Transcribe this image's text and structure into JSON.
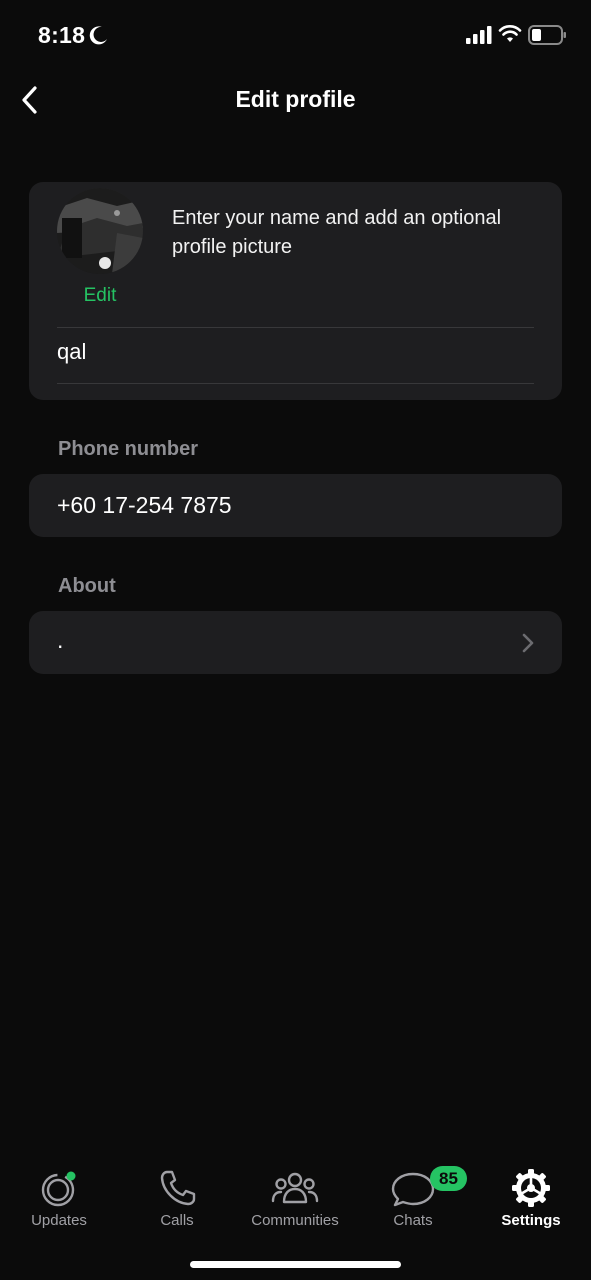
{
  "status_bar": {
    "time": "8:18"
  },
  "header": {
    "title": "Edit profile",
    "back_icon": "chevron-left-icon"
  },
  "profile": {
    "edit_label": "Edit",
    "hint": "Enter your name and add an optional profile picture",
    "name": "qal"
  },
  "phone": {
    "label": "Phone number",
    "value": "+60 17-254 7875"
  },
  "about": {
    "label": "About",
    "value": "."
  },
  "tabs": [
    {
      "label": "Updates",
      "icon": "updates-icon"
    },
    {
      "label": "Calls",
      "icon": "phone-icon"
    },
    {
      "label": "Communities",
      "icon": "communities-icon"
    },
    {
      "label": "Chats",
      "icon": "chat-icon"
    },
    {
      "label": "Settings",
      "icon": "gear-icon"
    }
  ],
  "chats_badge": "85",
  "colors": {
    "accent": "#25c363",
    "background": "#0b0b0b",
    "card": "#1e1e20",
    "secondary_text": "#8e8e93"
  }
}
